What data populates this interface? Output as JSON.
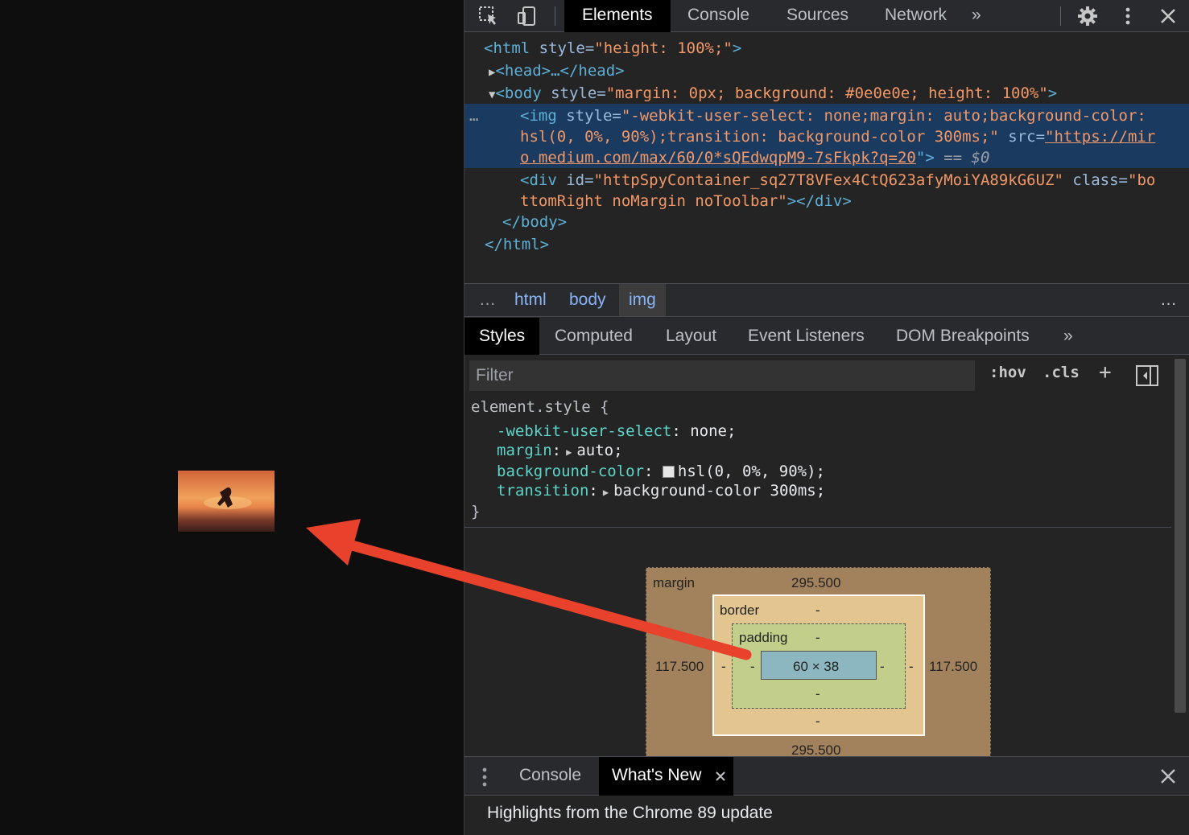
{
  "devtools": {
    "tabs": [
      "Elements",
      "Console",
      "Sources",
      "Network"
    ],
    "active_tab": "Elements",
    "more_tabs": "»",
    "icons": [
      "inspect-icon",
      "device-toggle-icon",
      "gear-icon",
      "kebab-menu-icon",
      "close-icon"
    ]
  },
  "dom": {
    "l1_tag": "<html ",
    "l1_attr": "style=",
    "l1_val": "\"height: 100%;\"",
    "l1_end": ">",
    "l2": "<head>…</head>",
    "l3_tag": "<body ",
    "l3_attr": "style=",
    "l3_val": "\"margin: 0px; background: #0e0e0e; height: 100%\"",
    "l3_end": ">",
    "l4_tag": "<img ",
    "l4_attr": "style=",
    "l4_val": "\"-webkit-user-select: none;margin: auto;background-color: ",
    "l5_val": "hsl(0, 0%, 90%);transition: background-color 300ms;\"",
    "l5_attr": " src=",
    "l5_link": "\"https://mir",
    "l6_link": "o.medium.com/max/60/0*sQEdwqpM9-7sFkpk?q=20",
    "l6_end": "\">",
    "l6_eq": " == $0",
    "l7_tag": "<div ",
    "l7_attr1": "id=",
    "l7_val1": "\"httpSpyContainer_sq27T8VFex4CtQ623afyMoiYA89kG6UZ\"",
    "l7_attr2": " class=",
    "l7_val2": "\"bo",
    "l8_val": "ttomRight noMargin noToolbar\"",
    "l8_end": "></div>",
    "l9": "</body>",
    "l10": "</html>",
    "ellipsis": "…"
  },
  "breadcrumbs": [
    "html",
    "body",
    "img"
  ],
  "breadcrumb_ellipsis": "…",
  "subtabs": [
    "Styles",
    "Computed",
    "Layout",
    "Event Listeners",
    "DOM Breakpoints"
  ],
  "subtabs_more": "»",
  "filter": {
    "placeholder": "Filter",
    "hov": ":hov",
    "cls": ".cls",
    "plus": "+"
  },
  "styles": {
    "selector": "element.style {",
    "rules": [
      {
        "prop": "-webkit-user-select",
        "value": "none;"
      },
      {
        "prop": "margin",
        "value": "auto;"
      },
      {
        "prop": "background-color",
        "value": "hsl(0, 0%, 90%);"
      },
      {
        "prop": "transition",
        "value": "background-color 300ms;"
      }
    ],
    "close": "}"
  },
  "boxmodel": {
    "margin_label": "margin",
    "margin_top": "295.500",
    "margin_bottom": "295.500",
    "margin_left": "117.500",
    "margin_right": "117.500",
    "border_label": "border",
    "border_value": "-",
    "padding_label": "padding",
    "padding_value": "-",
    "content": "60 × 38"
  },
  "drawer": {
    "tabs": [
      "Console",
      "What's New"
    ],
    "active_tab": "What's New",
    "content": "Highlights from the Chrome 89 update"
  },
  "colors": {
    "arrow": "#e8412c",
    "selection": "#1b3a5f"
  }
}
